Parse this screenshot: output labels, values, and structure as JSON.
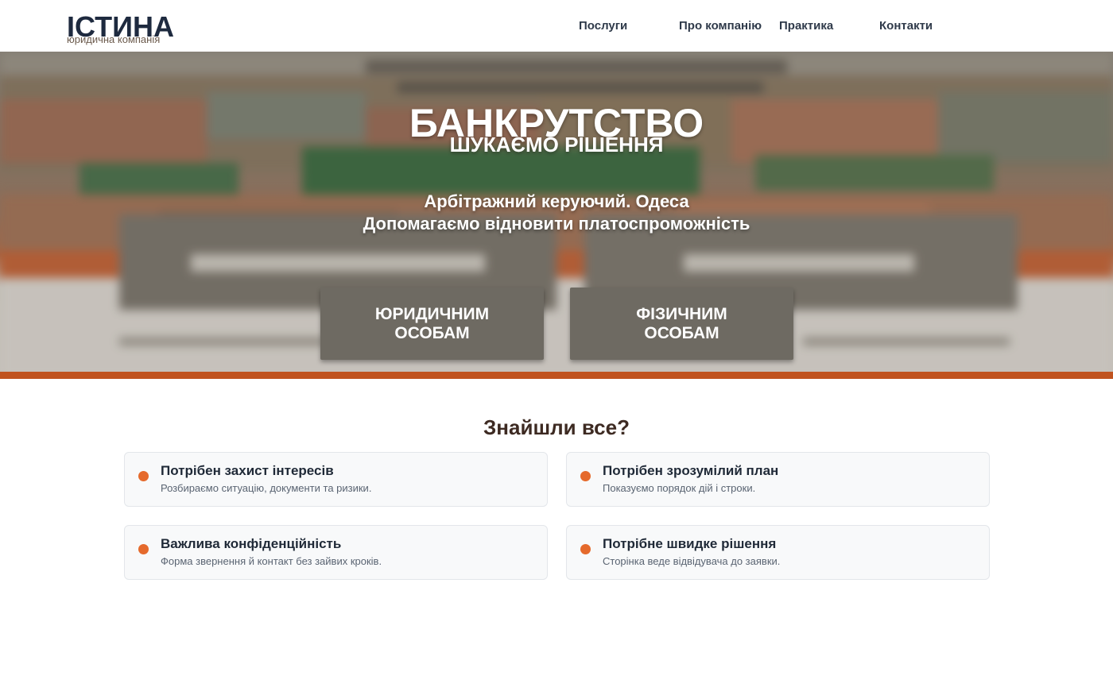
{
  "header": {
    "logo_title": "ІСТИНА",
    "logo_subtitle": "юридична компанія",
    "nav": [
      {
        "label": "Послуги"
      },
      {
        "label": "Про компанію"
      },
      {
        "label": "Практика"
      },
      {
        "label": "Контакти"
      }
    ]
  },
  "hero": {
    "title": "БАНКРУТСТВО",
    "subtitle": "ШУКАЄМО РІШЕННЯ",
    "line1": "Арбітражний керуючий. Одеса",
    "line2": "Допомагаємо відновити платоспроможність",
    "buttons": [
      {
        "line1": "ЮРИДИЧНИМ",
        "line2": "ОСОБАМ"
      },
      {
        "line1": "ФІЗИЧНИМ",
        "line2": "ОСОБАМ"
      }
    ]
  },
  "section": {
    "title": "Знайшли все?",
    "cards": [
      {
        "title": "Потрібен захист інтересів",
        "desc": "Розбираємо ситуацію, документи та ризики."
      },
      {
        "title": "Потрібен зрозумілий план",
        "desc": "Показуємо порядок дій і строки."
      },
      {
        "title": "Важлива конфіденційність",
        "desc": "Форма звернення й контакт без зайвих кроків."
      },
      {
        "title": "Потрібне швидке рішення",
        "desc": "Сторінка веде відвідувача до заявки."
      }
    ]
  },
  "colors": {
    "accent": "#e56a2c",
    "stripe": "#c0531f",
    "hero_button": "#6e6a62",
    "heading": "#3d2a22",
    "logo": "#1e2a3f"
  },
  "icons": {
    "card_bullet": "dot-icon"
  }
}
